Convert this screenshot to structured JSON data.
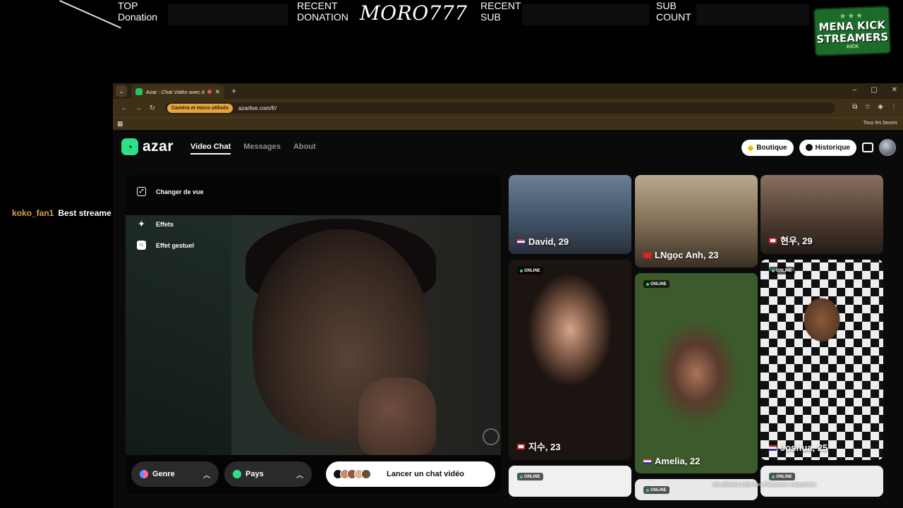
{
  "overlay": {
    "top_donation": [
      "TOP",
      "Donation"
    ],
    "recent_donation": [
      "RECENT",
      "DONATION"
    ],
    "recent_donation_name": "MORO777",
    "recent_sub": [
      "RECENT",
      "SUB"
    ],
    "sub_count": [
      "SUB",
      "COUNT"
    ],
    "badge": {
      "line1": "MENA KICK",
      "line2": "STREAMERS",
      "small": "KICK",
      "stars": "★★★"
    },
    "chat": {
      "user": "koko_fan1",
      "message": "Best streame"
    }
  },
  "browser": {
    "tab_title": "Azar : Chat Vidéo avec de n",
    "tab_close": "✕",
    "new_tab": "+",
    "window_controls": [
      "–",
      "▢",
      "✕"
    ],
    "nav_icons": [
      "←",
      "→",
      "↻"
    ],
    "permission_badge": "Caméra et micro utilisés",
    "url": "azarlive.com/fr/",
    "bookmarks_label": "Tous les favoris"
  },
  "azar": {
    "logo_text": "azar",
    "nav": {
      "video_chat": "Video Chat",
      "messages": "Messages",
      "about": "About"
    },
    "boutique": "Boutique",
    "historique": "Historique",
    "video_menu": {
      "change_view": "Changer de vue",
      "effects": "Effets",
      "gesture_effect": "Effet gestuel"
    },
    "controls": {
      "genre": "Genre",
      "pays": "Pays",
      "start": "Lancer un chat vidéo"
    },
    "online_label": "ONLINE",
    "disclaimer": "ont utilisées à des fins d'illustration uniquement.",
    "profiles": [
      {
        "name": "David, 29",
        "flag": "us"
      },
      {
        "name": "LNgọc Anh, 23",
        "flag": "vn"
      },
      {
        "name": "현우, 29",
        "flag": "kr"
      },
      {
        "name": "지수, 23",
        "flag": "kr"
      },
      {
        "name": "Amelia, 22",
        "flag": "us"
      },
      {
        "name": "Joshua, 25",
        "flag": "us"
      }
    ]
  },
  "colors": {
    "accent": "#2ee089",
    "browser_chrome": "#3f3118",
    "permission": "#e8a33d",
    "chat_user": "#d8a64b"
  }
}
